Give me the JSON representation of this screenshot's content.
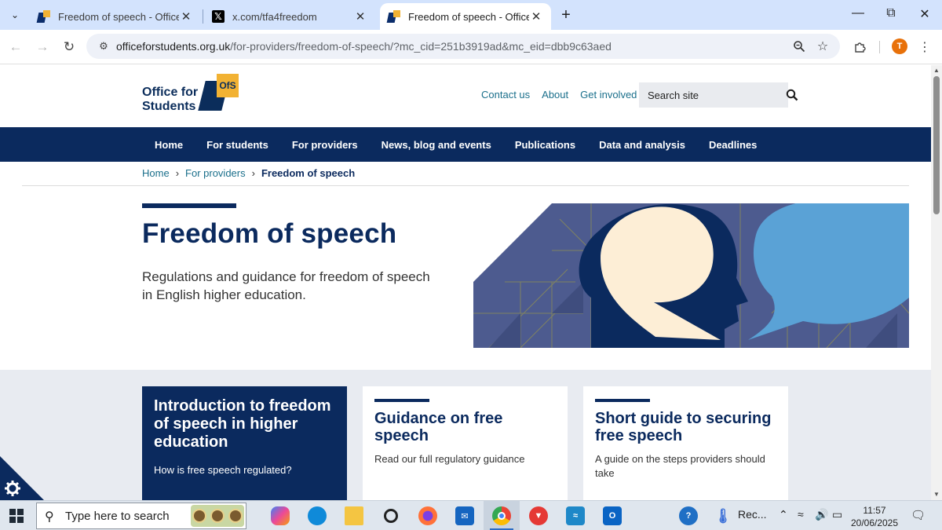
{
  "browser": {
    "tabs": [
      {
        "title": "Freedom of speech - Office for Students",
        "favicon": "ofs-favicon",
        "active": false
      },
      {
        "title": "x.com/tfa4freedom",
        "favicon": "x-favicon",
        "active": false
      },
      {
        "title": "Freedom of speech - Office for Students",
        "favicon": "ofs-favicon",
        "active": true
      }
    ],
    "url_host": "officeforstudents.org.uk",
    "url_path": "/for-providers/freedom-of-speech/?mc_cid=251b3919ad&mc_eid=dbb9c63aed",
    "profile_initial": "T"
  },
  "site": {
    "logo": {
      "line1": "Office for",
      "line2": "Students",
      "badge": "OfS"
    },
    "header_links": [
      "Contact us",
      "About",
      "Get involved"
    ],
    "search": {
      "placeholder": "Search site"
    },
    "nav": [
      "Home",
      "For students",
      "For providers",
      "News, blog and events",
      "Publications",
      "Data and analysis",
      "Deadlines"
    ],
    "breadcrumb": {
      "items": [
        "Home",
        "For providers"
      ],
      "current": "Freedom of speech"
    },
    "hero": {
      "title": "Freedom of speech",
      "subtitle": "Regulations and guidance for freedom of speech in English higher education."
    },
    "cards": [
      {
        "title": "Introduction to freedom of speech in higher education",
        "desc": "How is free speech regulated?"
      },
      {
        "title": "Guidance on free speech",
        "desc": "Read our full regulatory guidance"
      },
      {
        "title": "Short guide to securing free speech",
        "desc": "A guide on the steps providers should take"
      }
    ],
    "colors": {
      "navy": "#0b2a5e",
      "gold": "#f2b233",
      "link": "#1a6f8b",
      "band": "#e8ebf1"
    }
  },
  "taskbar": {
    "search_text": "Type here to search",
    "rec_label": "Rec...",
    "time": "11:57",
    "date": "20/06/2025"
  }
}
